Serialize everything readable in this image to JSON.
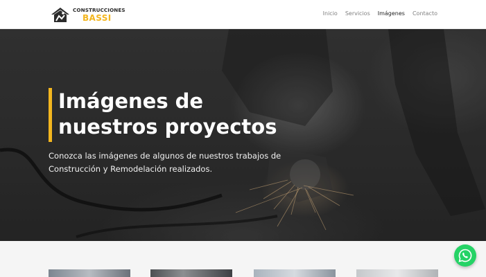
{
  "header": {
    "logo": {
      "line1": "CONSTRUCCIONES",
      "line2": "BASSI",
      "icon": "house-worker-icon"
    },
    "nav": [
      {
        "label": "Inicio",
        "active": false
      },
      {
        "label": "Servicios",
        "active": false
      },
      {
        "label": "Imágenes",
        "active": true
      },
      {
        "label": "Contacto",
        "active": false
      }
    ]
  },
  "hero": {
    "title_line1": "Imágenes de",
    "title_line2": "nuestros proyectos",
    "subtitle_line1": "Conozca las imágenes de algunos de nuestros trabajos de",
    "subtitle_line2": "Construcción y Remodelación realizados.",
    "accent_color": "#f3b61f"
  },
  "gallery": {
    "thumbnails": [
      "project-photo-1",
      "project-photo-2",
      "project-photo-3",
      "project-photo-4"
    ]
  },
  "floating": {
    "icon": "whatsapp-icon",
    "color": "#25d366"
  }
}
